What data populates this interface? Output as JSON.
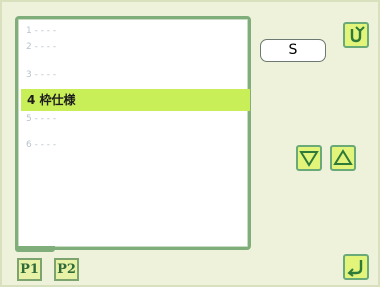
{
  "list": {
    "items": [
      {
        "label": "1 - - - -"
      },
      {
        "label": "2 - - - -"
      },
      {
        "label": "3 - - - -"
      },
      {
        "label": "4 枠仕様"
      },
      {
        "label": "5 - - - -"
      },
      {
        "label": "6 - - - -"
      }
    ],
    "selected_index": 3
  },
  "value_box": {
    "text": "S"
  },
  "pages": {
    "p1": "P1",
    "p2": "P2",
    "active": "P1"
  },
  "icons": {
    "top_right": "rotate-back-icon",
    "down": "triangle-down-icon",
    "up": "triangle-up-icon",
    "bottom_right": "return-enter-icon"
  },
  "colors": {
    "background": "#eef2da",
    "highlight": "#c8ef58",
    "accent_button": "#e3f47a",
    "frame": "#7fae7a"
  }
}
